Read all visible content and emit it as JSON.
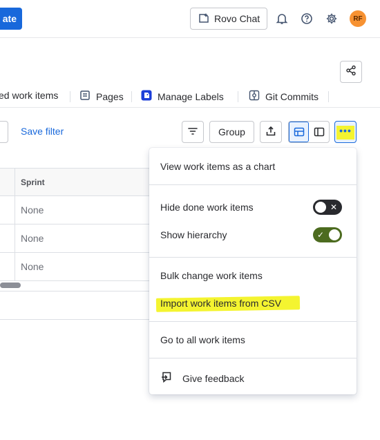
{
  "topbar": {
    "create_label": "ate",
    "rovo_label": "Rovo Chat",
    "avatar_initials": "RF"
  },
  "tabs": [
    {
      "label": "ed work items"
    },
    {
      "label": "Pages"
    },
    {
      "label": "Manage Labels"
    },
    {
      "label": "Git Commits"
    }
  ],
  "filters": {
    "save_filter": "Save filter",
    "group_label": "Group"
  },
  "table": {
    "columns": [
      {
        "label": "Sprint"
      }
    ],
    "rows": [
      {
        "sprint": "None"
      },
      {
        "sprint": "None"
      },
      {
        "sprint": "None"
      }
    ]
  },
  "menu": {
    "chart": "View work items as a chart",
    "hide_done": "Hide done work items",
    "hide_done_on": false,
    "show_hierarchy": "Show hierarchy",
    "show_hierarchy_on": true,
    "bulk_change": "Bulk change work items",
    "import_csv": "Import work items from CSV",
    "go_all": "Go to all work items",
    "feedback": "Give feedback"
  },
  "colors": {
    "accent": "#1868db",
    "highlight": "#f4f430",
    "toggle_on": "#4c6b1f",
    "toggle_off": "#292a2e",
    "avatar": "#f79232"
  },
  "icons": [
    "rovo-icon",
    "bell-icon",
    "help-icon",
    "gear-icon",
    "share-icon",
    "pages-icon",
    "labels-icon",
    "git-commits-icon",
    "filter-icon",
    "export-icon",
    "table-view-icon",
    "panel-view-icon",
    "more-icon",
    "feedback-icon"
  ]
}
